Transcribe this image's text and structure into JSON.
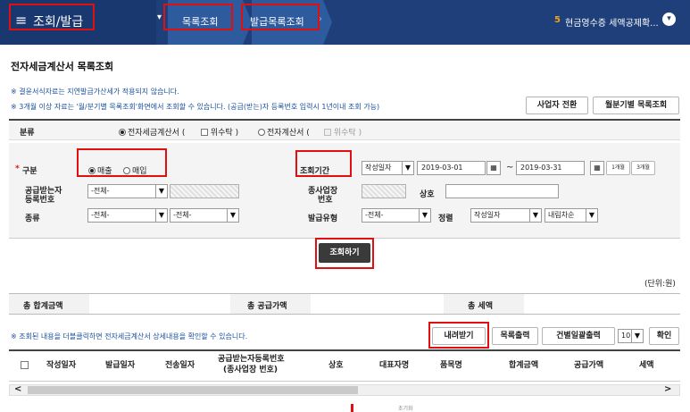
{
  "header": {
    "menu_icon": "≡",
    "section": "조회/발급",
    "crumb1": "목록조회",
    "crumb2": "발급목록조회",
    "notice_num": "5",
    "notice_text": "현금영수증 세액공제확...",
    "colors": {
      "bar": "#1f3f7a",
      "crumb": "#2e5a9e",
      "accent": "#f0a21e",
      "highlight": "#e01010"
    }
  },
  "page": {
    "title": "전자세금계산서 목록조회",
    "note1": "※ 결윤서식자료는 지연발급가산세가 적용되지 않습니다.",
    "note2": "※ 3개월 이상 자료는 '월/분기별 목록조회'화면에서 조회할 수 있습니다. (공급(받는)자 등록번호 입력시 1년이내 조회 가능)",
    "btn_switch": "사업자 전환",
    "btn_monthly": "월분기별 목록조회"
  },
  "form": {
    "cat_label": "분류",
    "cat_opt1": "전자세금계산서 (",
    "cat_opt1_cb": "위수탁 )",
    "cat_opt2": "전자계산서 (",
    "cat_opt2_cb": "위수탁 )",
    "gubun_label": "구분",
    "gubun_star": "*",
    "gubun_sale": "매출",
    "gubun_buy": "매입",
    "period_label": "조회기간",
    "period_type": "작성일자",
    "date_from": "2019-03-01",
    "date_to": "2019-03-31",
    "tilde": "~",
    "calendar_glyph": "▦",
    "btn_1m": "1개월",
    "btn_3m": "3개월",
    "recv_label1": "공급받는자",
    "recv_label2": "등록번호",
    "recv_select": "-전체-",
    "branch_label1": "종사업장",
    "branch_label2": "번호",
    "company_label": "상호",
    "kind_label": "종류",
    "kind_select1": "-전체-",
    "kind_select2": "-전체-",
    "issue_label": "발급유형",
    "issue_select": "-전체-",
    "sort_label": "정렬",
    "sort_select": "작성일자",
    "order_select": "내림차순",
    "search_btn": "조회하기"
  },
  "summary": {
    "unit": "(단위:원)",
    "total_label": "총 합계금액",
    "supply_label": "총 공급가액",
    "tax_label": "총 세액"
  },
  "list": {
    "dblclick_note": "※ 조회된 내용을 더블클릭하면 전자세금계산서 상세내용을 확인할 수 있습니다.",
    "btn_download": "내려받기",
    "btn_print": "목록출력",
    "btn_batch": "건별일괄출력",
    "page_size": "10",
    "btn_confirm": "확인",
    "columns": [
      "작성일자",
      "발급일자",
      "전송일자",
      "공급받는자등록번호",
      "(종사업장 번호)",
      "상호",
      "대표자명",
      "품목명",
      "합계금액",
      "공급가액",
      "세액"
    ],
    "scroll_left": "<",
    "scroll_right": ">",
    "cut_text": "초기화"
  },
  "icons": {
    "dropdown": "chevron-down-icon",
    "calendar": "calendar-icon",
    "menu": "hamburger-icon"
  }
}
